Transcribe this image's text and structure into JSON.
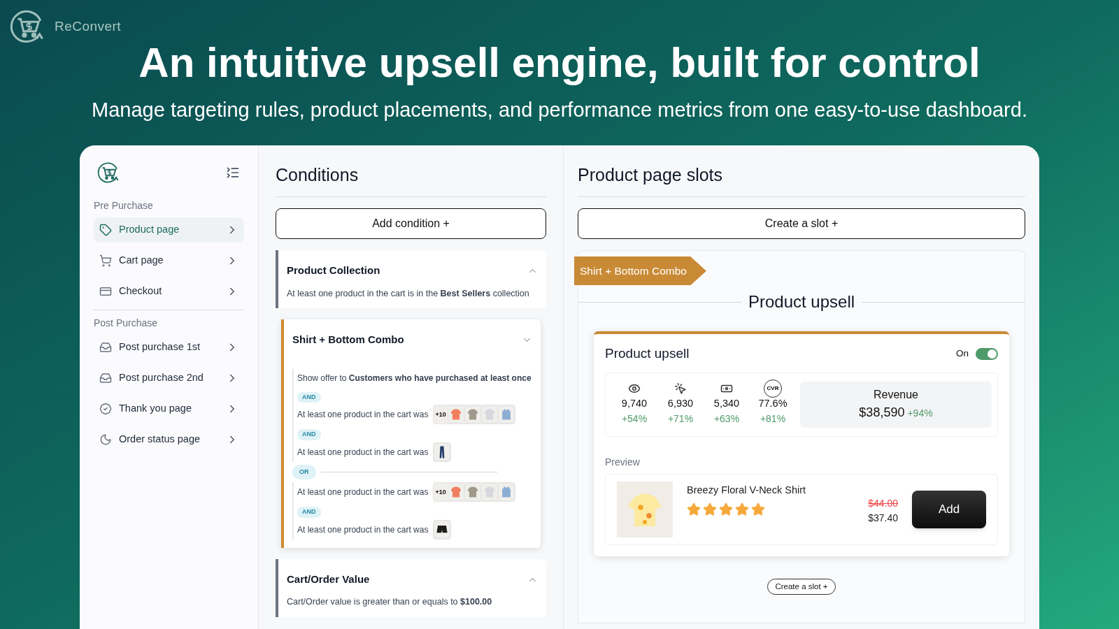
{
  "brand": {
    "name": "ReConvert"
  },
  "hero": {
    "title": "An intuitive upsell engine, built for control",
    "subtitle": "Manage targeting rules, product placements, and performance metrics from one easy-to-use dashboard."
  },
  "sidebar": {
    "sections": [
      {
        "title": "Pre Purchase",
        "items": [
          {
            "label": "Product page",
            "kind": "tag",
            "selected": true
          },
          {
            "label": "Cart page",
            "kind": "cart",
            "selected": false
          },
          {
            "label": "Checkout",
            "kind": "card",
            "selected": false
          }
        ]
      },
      {
        "title": "Post Purchase",
        "items": [
          {
            "label": "Post purchase 1st",
            "kind": "box",
            "selected": false
          },
          {
            "label": "Post purchase 2nd",
            "kind": "box",
            "selected": false
          },
          {
            "label": "Thank you page",
            "kind": "badge",
            "selected": false
          },
          {
            "label": "Order status page",
            "kind": "moon",
            "selected": false
          }
        ]
      }
    ]
  },
  "conditions": {
    "title": "Conditions",
    "add_button": "Add condition +",
    "cards": [
      {
        "title": "Product Collection",
        "expanded": true,
        "color": "#6b7280",
        "description": "At least one product in the cart is in the **Best Sellers** collection"
      },
      {
        "title": "Shirt + Bottom Combo",
        "expanded": false,
        "color": "#d08a2e",
        "groups": [
          {
            "rules": [
              {
                "text": "Show offer to **Customers who have purchased at least once**"
              },
              {
                "connector": "AND",
                "text": "At least one product in the cart was",
                "more": "+10",
                "thumbnails": [
                  {
                    "kind": "shirt"
                  },
                  {
                    "kind": "shirt"
                  },
                  {
                    "kind": "shirt"
                  },
                  {
                    "kind": "tank"
                  }
                ]
              },
              {
                "connector": "AND",
                "text": "At least one product in the cart was",
                "thumbnails": [
                  {
                    "kind": "jeans"
                  }
                ]
              }
            ]
          },
          {
            "separator": "OR",
            "rules": [
              {
                "text": "At least one product in the cart was",
                "more": "+10",
                "thumbnails": [
                  {
                    "kind": "shirt"
                  },
                  {
                    "kind": "shirt"
                  },
                  {
                    "kind": "shirt"
                  },
                  {
                    "kind": "tank"
                  }
                ]
              },
              {
                "connector": "AND",
                "text": "At least one product in the cart was",
                "thumbnails": [
                  {
                    "kind": "shorts"
                  }
                ]
              }
            ]
          }
        ]
      },
      {
        "title": "Cart/Order Value",
        "expanded": true,
        "color": "#6b7280",
        "description": "Cart/Order value is greater than or equals to **$100.00**"
      }
    ]
  },
  "slots": {
    "title": "Product page slots",
    "create_button": "Create a slot +",
    "slot": {
      "ribbon": "Shirt + Bottom Combo",
      "heading": "Product upsell",
      "widget": {
        "title": "Product upsell",
        "toggle_label": "On",
        "on": true,
        "stats": [
          {
            "kind": "eye",
            "value": "9,740",
            "change": "+54%"
          },
          {
            "kind": "cursor",
            "value": "6,930",
            "change": "+71%"
          },
          {
            "kind": "money",
            "value": "5,340",
            "change": "+63%"
          },
          {
            "kind": "cvr",
            "badge": "CVR",
            "value": "77.6%",
            "change": "+81%"
          }
        ],
        "revenue": {
          "label": "Revenue",
          "value": "$38,590",
          "change": "+94%"
        },
        "preview_label": "Preview",
        "product": {
          "name": "Breezy Floral V-Neck Shirt",
          "stars": 5,
          "old_price": "$44.00",
          "price": "$37.40",
          "button": "Add"
        }
      }
    },
    "bottom_button": "Create a slot +"
  }
}
